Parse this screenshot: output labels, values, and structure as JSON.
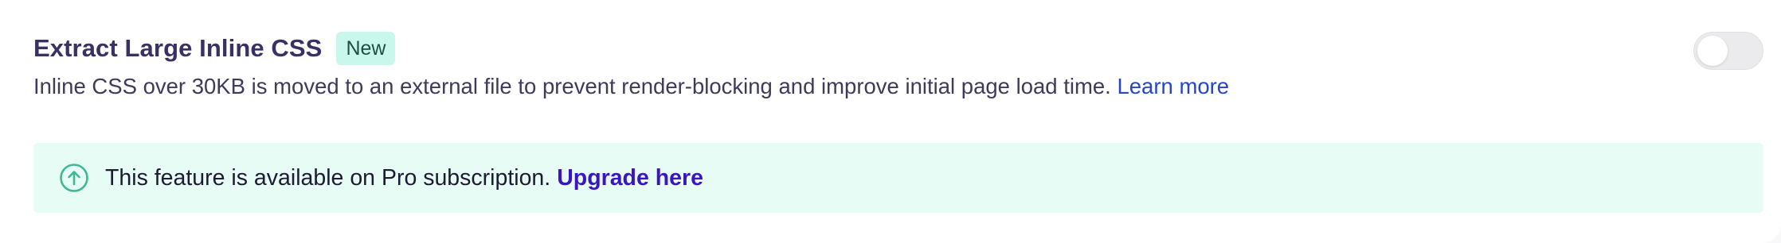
{
  "feature": {
    "title": "Extract Large Inline CSS",
    "badge": "New",
    "description": "Inline CSS over 30KB is moved to an external file to prevent render-blocking and improve initial page load time.",
    "learn_more_label": "Learn more",
    "toggle_enabled": false
  },
  "notice": {
    "icon": "arrow-up-circle-icon",
    "text": "This feature is available on Pro subscription.",
    "link_label": "Upgrade here"
  },
  "colors": {
    "title": "#3a3063",
    "badge_bg": "#c9f7ec",
    "link": "#2646c9",
    "notice_bg": "#e8fcf6",
    "notice_icon": "#3fb893",
    "upgrade_link": "#3a16c2"
  }
}
